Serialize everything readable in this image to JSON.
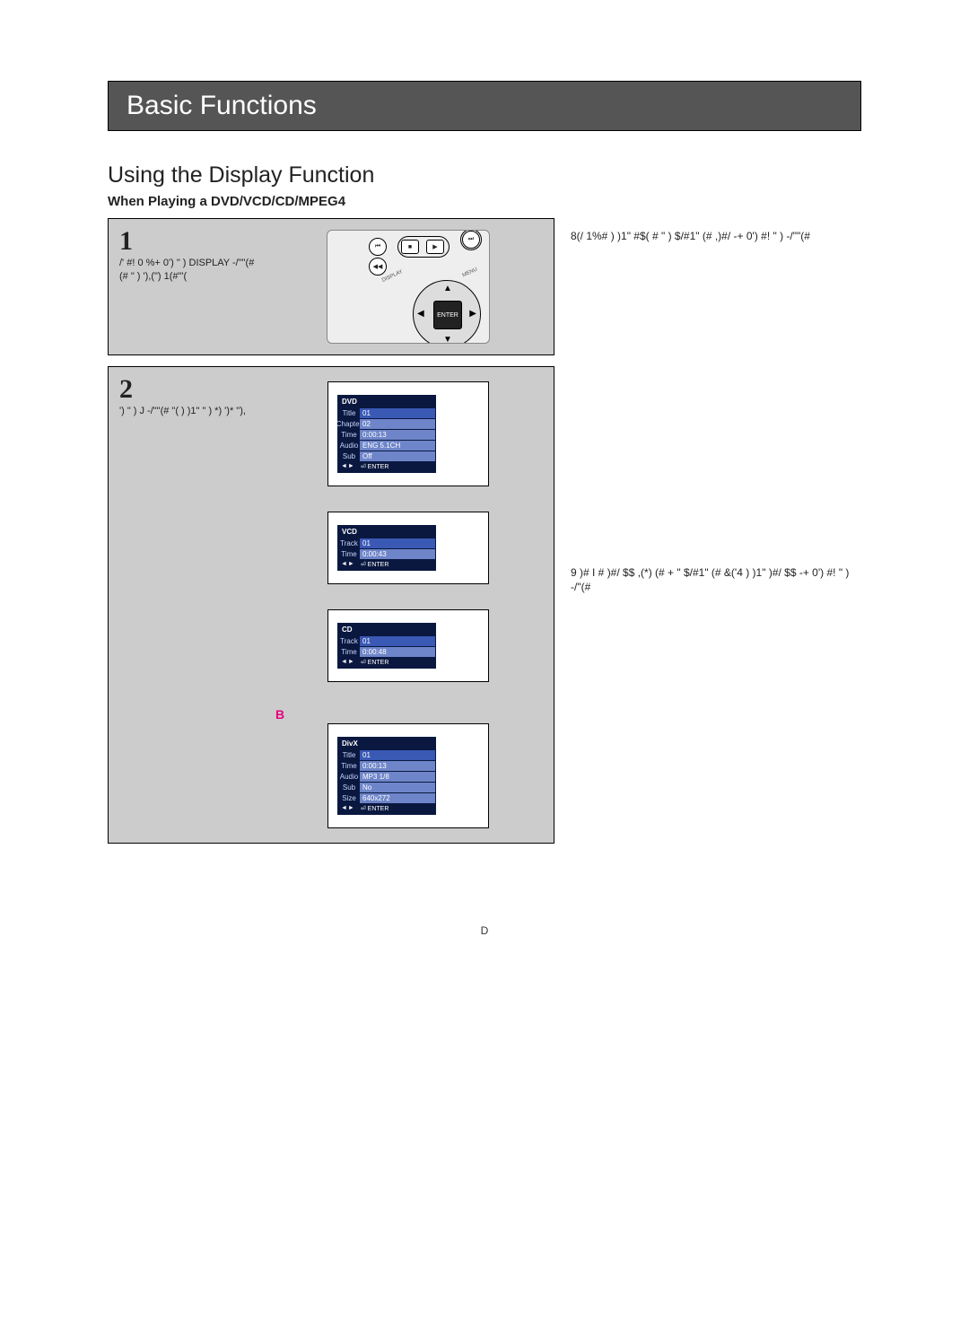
{
  "titlebar": {
    "title": "Basic Functions"
  },
  "section": {
    "heading": "Using the Display Function",
    "context": "When Playing a DVD/VCD/CD/MPEG4"
  },
  "steps": {
    "s1": {
      "num": "1",
      "desc": "/' #! 0 %+ 0')   \" ) DISPLAY -/\"\"(# (# \" ) '),(\") 1(#\"'(",
      "remote": {
        "enter": "ENTER"
      }
    },
    "s2": {
      "num": "2",
      "desc": "')   \" )       J   -/\"\"(# \"( ) )1\" \" ) *) ')* \"),",
      "osd": {
        "dvd": {
          "head": "DVD",
          "rows": [
            {
              "icon": "Title",
              "val": "01"
            },
            {
              "icon": "Chapter",
              "val": "02"
            },
            {
              "icon": "Time",
              "val": "0:00:13"
            },
            {
              "icon": "Audio",
              "val": "ENG 5.1CH"
            },
            {
              "icon": "Sub",
              "val": "Off"
            }
          ],
          "foot_icons": "◄►",
          "foot_enter": "⏎ ENTER"
        },
        "vcd": {
          "head": "VCD",
          "rows": [
            {
              "icon": "Track",
              "val": "01"
            },
            {
              "icon": "Time",
              "val": "0:00:43"
            }
          ],
          "foot_icons": "◄►",
          "foot_enter": "⏎ ENTER"
        },
        "cd": {
          "head": "CD",
          "rows": [
            {
              "icon": "Track",
              "val": "01"
            },
            {
              "icon": "Time",
              "val": "0:00:48"
            }
          ],
          "foot_icons": "◄►",
          "foot_enter": "⏎ ENTER"
        },
        "divx": {
          "letter": "B",
          "head": "DivX",
          "rows": [
            {
              "icon": "Title",
              "val": "01"
            },
            {
              "icon": "Time",
              "val": "0:00:13"
            },
            {
              "icon": "Audio",
              "val": "MP3 1/8"
            },
            {
              "icon": "Sub",
              "val": "No"
            },
            {
              "icon": "Size",
              "val": "640x272"
            }
          ],
          "foot_icons": "◄►",
          "foot_enter": "⏎ ENTER"
        }
      }
    }
  },
  "side_notes": {
    "n1": "8(/ 1%#  ) )1\"  #$(  # \" ) $/#1\" (# ,)#/ -+ 0')   #! \" )       -/\"\"(#",
    "n2": "9 )#     I    #  )#/  $$ ,(*) (# + \" $/#1\" (# &('4   ) )1\"  )#/  $$ -+ 0')   #! \" )       -/\"(#"
  },
  "page_footer": "D"
}
